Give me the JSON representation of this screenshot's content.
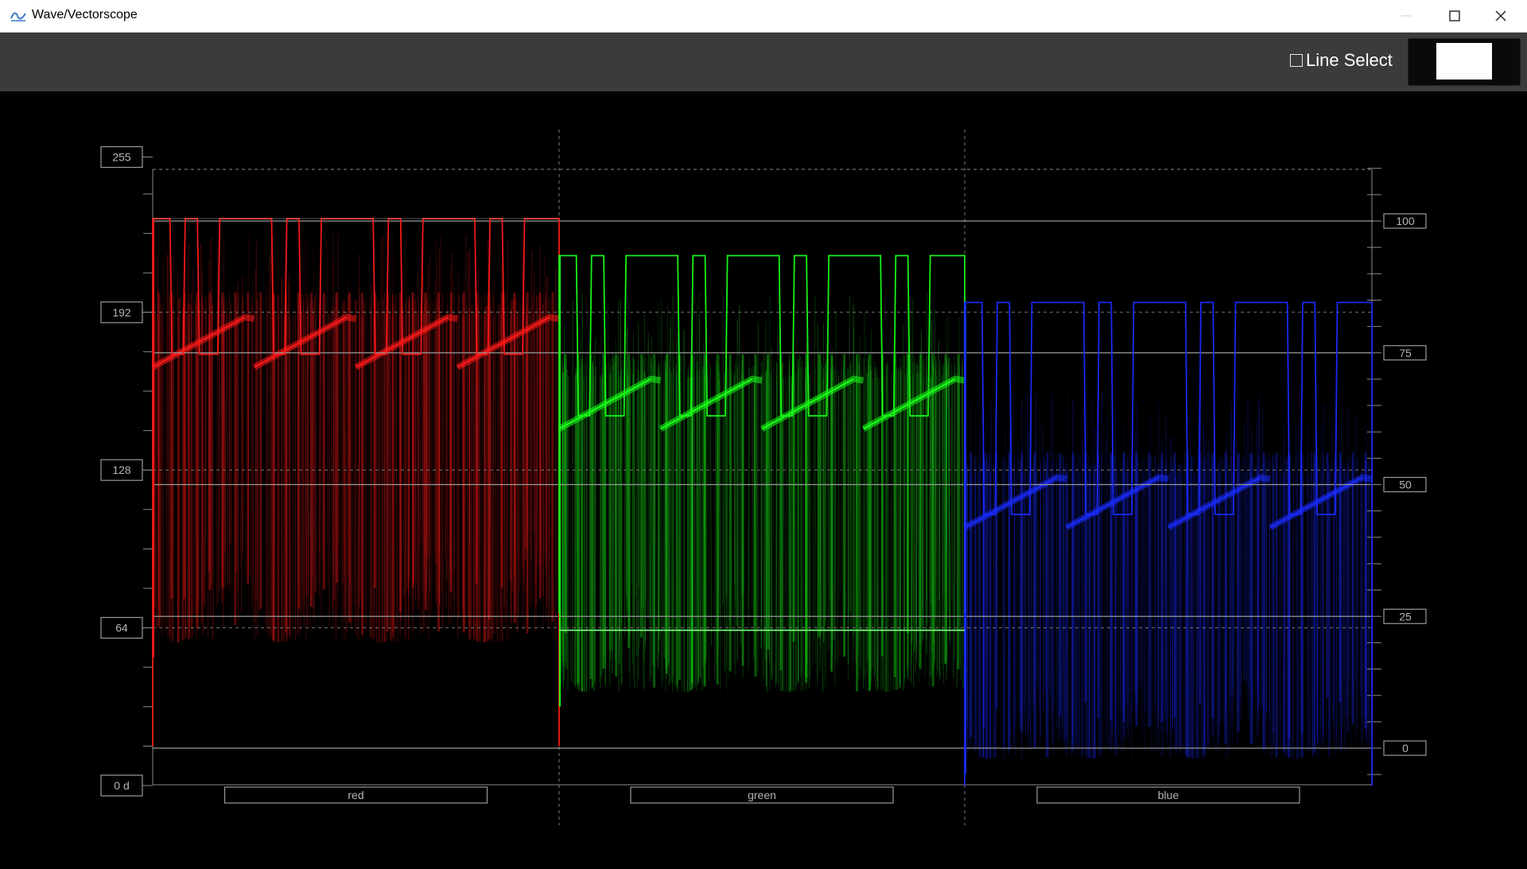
{
  "window": {
    "title": "Wave/Vectorscope",
    "controls": [
      "minimize",
      "maximize",
      "close"
    ]
  },
  "toolbar": {
    "line_select_label": "Line Select",
    "line_select_checked": false,
    "preview_color": "#ffffff"
  },
  "scope": {
    "left_scale_labels": [
      "255",
      "192",
      "128",
      "64",
      "0 d"
    ],
    "right_scale_labels": [
      "100",
      "75",
      "50",
      "25",
      "0"
    ],
    "channels": [
      {
        "name": "red",
        "color": "#ff1a1a"
      },
      {
        "name": "green",
        "color": "#1aff1a"
      },
      {
        "name": "blue",
        "color": "#1a2bff"
      }
    ]
  }
}
